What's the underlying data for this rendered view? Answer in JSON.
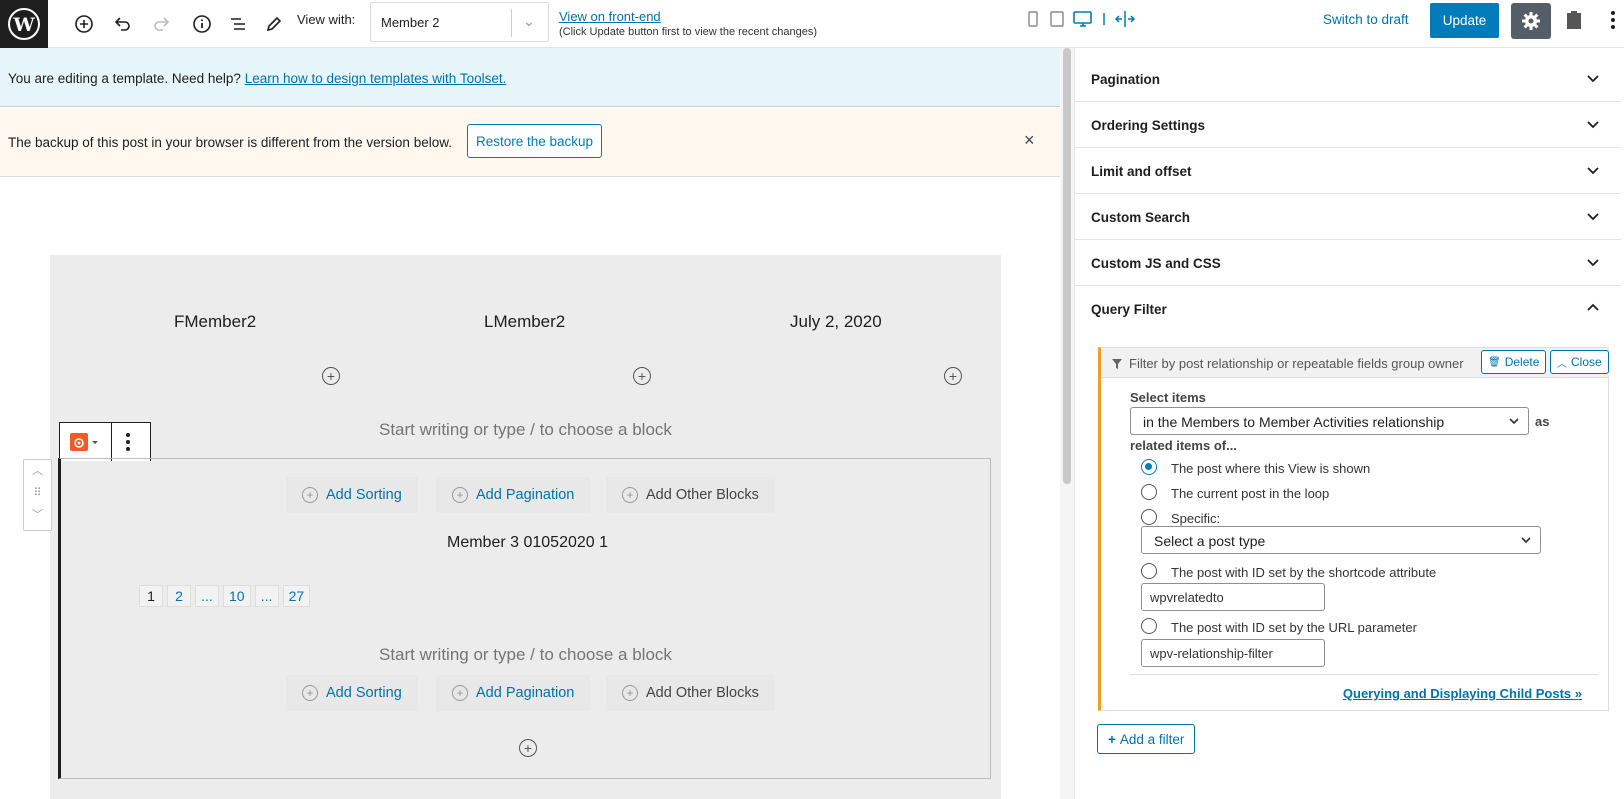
{
  "toolbar": {
    "view_with_label": "View with:",
    "view_with_value": "Member 2",
    "view_frontend_link": "View on front-end",
    "view_frontend_note": "(Click Update button first to view the recent changes)",
    "switch_to_draft": "Switch to draft",
    "update": "Update"
  },
  "notices": {
    "info_text": "You are editing a template. Need help?",
    "info_link": "Learn how to design templates with Toolset.",
    "backup_text": "The backup of this post in your browser is different from the version below.",
    "restore_button": "Restore the backup",
    "dismiss": "×"
  },
  "canvas": {
    "fields": [
      "FMember2",
      "LMember2",
      "July 2, 2020"
    ],
    "placeholder": "Start writing or type / to choose a block",
    "actions": {
      "sorting": "Add Sorting",
      "pagination": "Add Pagination",
      "other": "Add Other Blocks"
    },
    "member_line": "Member 3 01052020 1",
    "pages": [
      "1",
      "2",
      "...",
      "10",
      "...",
      "27"
    ]
  },
  "sidebar": {
    "panels": [
      "Pagination",
      "Ordering Settings",
      "Limit and offset",
      "Custom Search",
      "Custom JS and CSS",
      "Query Filter"
    ],
    "query_filter": {
      "header": "Filter by post relationship or repeatable fields group owner",
      "delete": "Delete",
      "close": "Close",
      "select_items_label": "Select items",
      "relationship_value": "in the Members to Member Activities relationship",
      "as_label": "as",
      "related_label": "related items of...",
      "options": [
        "The post where this View is shown",
        "The current post in the loop",
        "Specific:",
        "The post with ID set by the shortcode attribute",
        "The post with ID set by the URL parameter"
      ],
      "post_type_placeholder": "Select a post type",
      "shortcode_value": "wpvrelatedto",
      "url_param_value": "wpv-relationship-filter",
      "doc_link": "Querying and Displaying Child Posts »"
    },
    "add_filter": "Add a filter"
  }
}
